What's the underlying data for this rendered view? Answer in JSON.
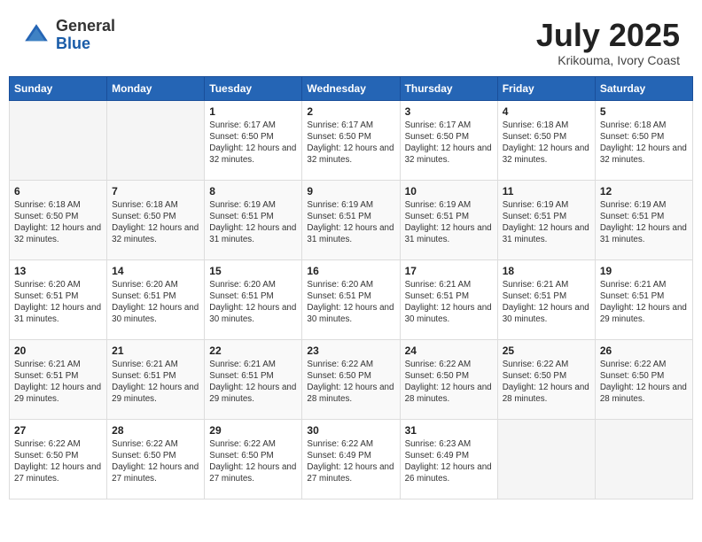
{
  "header": {
    "logo_general": "General",
    "logo_blue": "Blue",
    "month_year": "July 2025",
    "location": "Krikouma, Ivory Coast"
  },
  "weekdays": [
    "Sunday",
    "Monday",
    "Tuesday",
    "Wednesday",
    "Thursday",
    "Friday",
    "Saturday"
  ],
  "weeks": [
    [
      {
        "day": "",
        "sunrise": "",
        "sunset": "",
        "daylight": ""
      },
      {
        "day": "",
        "sunrise": "",
        "sunset": "",
        "daylight": ""
      },
      {
        "day": "1",
        "sunrise": "Sunrise: 6:17 AM",
        "sunset": "Sunset: 6:50 PM",
        "daylight": "Daylight: 12 hours and 32 minutes."
      },
      {
        "day": "2",
        "sunrise": "Sunrise: 6:17 AM",
        "sunset": "Sunset: 6:50 PM",
        "daylight": "Daylight: 12 hours and 32 minutes."
      },
      {
        "day": "3",
        "sunrise": "Sunrise: 6:17 AM",
        "sunset": "Sunset: 6:50 PM",
        "daylight": "Daylight: 12 hours and 32 minutes."
      },
      {
        "day": "4",
        "sunrise": "Sunrise: 6:18 AM",
        "sunset": "Sunset: 6:50 PM",
        "daylight": "Daylight: 12 hours and 32 minutes."
      },
      {
        "day": "5",
        "sunrise": "Sunrise: 6:18 AM",
        "sunset": "Sunset: 6:50 PM",
        "daylight": "Daylight: 12 hours and 32 minutes."
      }
    ],
    [
      {
        "day": "6",
        "sunrise": "Sunrise: 6:18 AM",
        "sunset": "Sunset: 6:50 PM",
        "daylight": "Daylight: 12 hours and 32 minutes."
      },
      {
        "day": "7",
        "sunrise": "Sunrise: 6:18 AM",
        "sunset": "Sunset: 6:50 PM",
        "daylight": "Daylight: 12 hours and 32 minutes."
      },
      {
        "day": "8",
        "sunrise": "Sunrise: 6:19 AM",
        "sunset": "Sunset: 6:51 PM",
        "daylight": "Daylight: 12 hours and 31 minutes."
      },
      {
        "day": "9",
        "sunrise": "Sunrise: 6:19 AM",
        "sunset": "Sunset: 6:51 PM",
        "daylight": "Daylight: 12 hours and 31 minutes."
      },
      {
        "day": "10",
        "sunrise": "Sunrise: 6:19 AM",
        "sunset": "Sunset: 6:51 PM",
        "daylight": "Daylight: 12 hours and 31 minutes."
      },
      {
        "day": "11",
        "sunrise": "Sunrise: 6:19 AM",
        "sunset": "Sunset: 6:51 PM",
        "daylight": "Daylight: 12 hours and 31 minutes."
      },
      {
        "day": "12",
        "sunrise": "Sunrise: 6:19 AM",
        "sunset": "Sunset: 6:51 PM",
        "daylight": "Daylight: 12 hours and 31 minutes."
      }
    ],
    [
      {
        "day": "13",
        "sunrise": "Sunrise: 6:20 AM",
        "sunset": "Sunset: 6:51 PM",
        "daylight": "Daylight: 12 hours and 31 minutes."
      },
      {
        "day": "14",
        "sunrise": "Sunrise: 6:20 AM",
        "sunset": "Sunset: 6:51 PM",
        "daylight": "Daylight: 12 hours and 30 minutes."
      },
      {
        "day": "15",
        "sunrise": "Sunrise: 6:20 AM",
        "sunset": "Sunset: 6:51 PM",
        "daylight": "Daylight: 12 hours and 30 minutes."
      },
      {
        "day": "16",
        "sunrise": "Sunrise: 6:20 AM",
        "sunset": "Sunset: 6:51 PM",
        "daylight": "Daylight: 12 hours and 30 minutes."
      },
      {
        "day": "17",
        "sunrise": "Sunrise: 6:21 AM",
        "sunset": "Sunset: 6:51 PM",
        "daylight": "Daylight: 12 hours and 30 minutes."
      },
      {
        "day": "18",
        "sunrise": "Sunrise: 6:21 AM",
        "sunset": "Sunset: 6:51 PM",
        "daylight": "Daylight: 12 hours and 30 minutes."
      },
      {
        "day": "19",
        "sunrise": "Sunrise: 6:21 AM",
        "sunset": "Sunset: 6:51 PM",
        "daylight": "Daylight: 12 hours and 29 minutes."
      }
    ],
    [
      {
        "day": "20",
        "sunrise": "Sunrise: 6:21 AM",
        "sunset": "Sunset: 6:51 PM",
        "daylight": "Daylight: 12 hours and 29 minutes."
      },
      {
        "day": "21",
        "sunrise": "Sunrise: 6:21 AM",
        "sunset": "Sunset: 6:51 PM",
        "daylight": "Daylight: 12 hours and 29 minutes."
      },
      {
        "day": "22",
        "sunrise": "Sunrise: 6:21 AM",
        "sunset": "Sunset: 6:51 PM",
        "daylight": "Daylight: 12 hours and 29 minutes."
      },
      {
        "day": "23",
        "sunrise": "Sunrise: 6:22 AM",
        "sunset": "Sunset: 6:50 PM",
        "daylight": "Daylight: 12 hours and 28 minutes."
      },
      {
        "day": "24",
        "sunrise": "Sunrise: 6:22 AM",
        "sunset": "Sunset: 6:50 PM",
        "daylight": "Daylight: 12 hours and 28 minutes."
      },
      {
        "day": "25",
        "sunrise": "Sunrise: 6:22 AM",
        "sunset": "Sunset: 6:50 PM",
        "daylight": "Daylight: 12 hours and 28 minutes."
      },
      {
        "day": "26",
        "sunrise": "Sunrise: 6:22 AM",
        "sunset": "Sunset: 6:50 PM",
        "daylight": "Daylight: 12 hours and 28 minutes."
      }
    ],
    [
      {
        "day": "27",
        "sunrise": "Sunrise: 6:22 AM",
        "sunset": "Sunset: 6:50 PM",
        "daylight": "Daylight: 12 hours and 27 minutes."
      },
      {
        "day": "28",
        "sunrise": "Sunrise: 6:22 AM",
        "sunset": "Sunset: 6:50 PM",
        "daylight": "Daylight: 12 hours and 27 minutes."
      },
      {
        "day": "29",
        "sunrise": "Sunrise: 6:22 AM",
        "sunset": "Sunset: 6:50 PM",
        "daylight": "Daylight: 12 hours and 27 minutes."
      },
      {
        "day": "30",
        "sunrise": "Sunrise: 6:22 AM",
        "sunset": "Sunset: 6:49 PM",
        "daylight": "Daylight: 12 hours and 27 minutes."
      },
      {
        "day": "31",
        "sunrise": "Sunrise: 6:23 AM",
        "sunset": "Sunset: 6:49 PM",
        "daylight": "Daylight: 12 hours and 26 minutes."
      },
      {
        "day": "",
        "sunrise": "",
        "sunset": "",
        "daylight": ""
      },
      {
        "day": "",
        "sunrise": "",
        "sunset": "",
        "daylight": ""
      }
    ]
  ]
}
